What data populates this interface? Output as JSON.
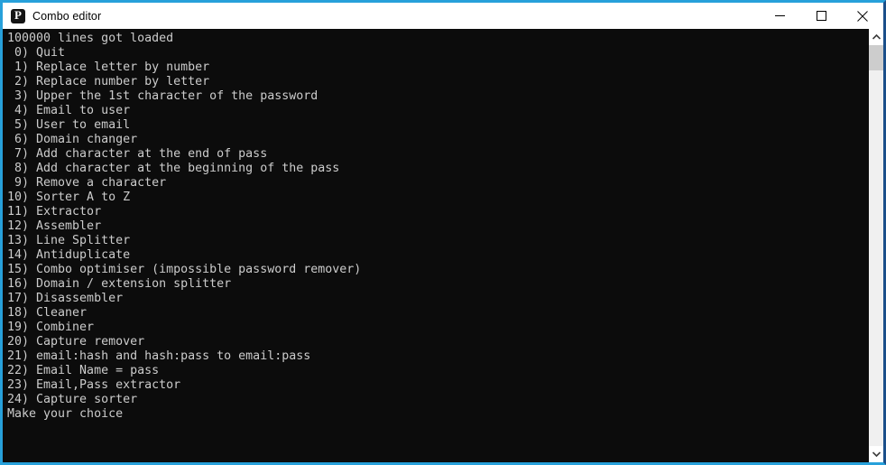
{
  "window": {
    "title": "Combo editor",
    "icon": "padlock-p-icon",
    "border_color_active": "#27a0da",
    "border_color_right": "#1b4f8a",
    "controls": [
      {
        "name": "minimize",
        "glyph": "minimize-icon"
      },
      {
        "name": "maximize",
        "glyph": "maximize-icon"
      },
      {
        "name": "close",
        "glyph": "close-icon"
      }
    ]
  },
  "console": {
    "background": "#0c0c0c",
    "foreground": "#cccccc",
    "status_line": "100000 lines got loaded",
    "menu_items": [
      " 0) Quit",
      " 1) Replace letter by number",
      " 2) Replace number by letter",
      " 3) Upper the 1st character of the password",
      " 4) Email to user",
      " 5) User to email",
      " 6) Domain changer",
      " 7) Add character at the end of pass",
      " 8) Add character at the beginning of the pass",
      " 9) Remove a character",
      "10) Sorter A to Z",
      "11) Extractor",
      "12) Assembler",
      "13) Line Splitter",
      "14) Antiduplicate",
      "15) Combo optimiser (impossible password remover)",
      "16) Domain / extension splitter",
      "17) Disassembler",
      "18) Cleaner",
      "19) Combiner",
      "20) Capture remover",
      "21) email:hash and hash:pass to email:pass",
      "22) Email Name = pass",
      "23) Email,Pass extractor",
      "24) Capture sorter"
    ],
    "prompt": "Make your choice",
    "text": "100000 lines got loaded\n 0) Quit\n 1) Replace letter by number\n 2) Replace number by letter\n 3) Upper the 1st character of the password\n 4) Email to user\n 5) User to email\n 6) Domain changer\n 7) Add character at the end of pass\n 8) Add character at the beginning of the pass\n 9) Remove a character\n10) Sorter A to Z\n11) Extractor\n12) Assembler\n13) Line Splitter\n14) Antiduplicate\n15) Combo optimiser (impossible password remover)\n16) Domain / extension splitter\n17) Disassembler\n18) Cleaner\n19) Combiner\n20) Capture remover\n21) email:hash and hash:pass to email:pass\n22) Email Name = pass\n23) Email,Pass extractor\n24) Capture sorter\nMake your choice"
  },
  "scrollbar": {
    "up_arrow": "chevron-up-icon",
    "down_arrow": "chevron-down-icon",
    "thumb_color": "#cdcdcd",
    "track_color": "#f0f0f0"
  }
}
